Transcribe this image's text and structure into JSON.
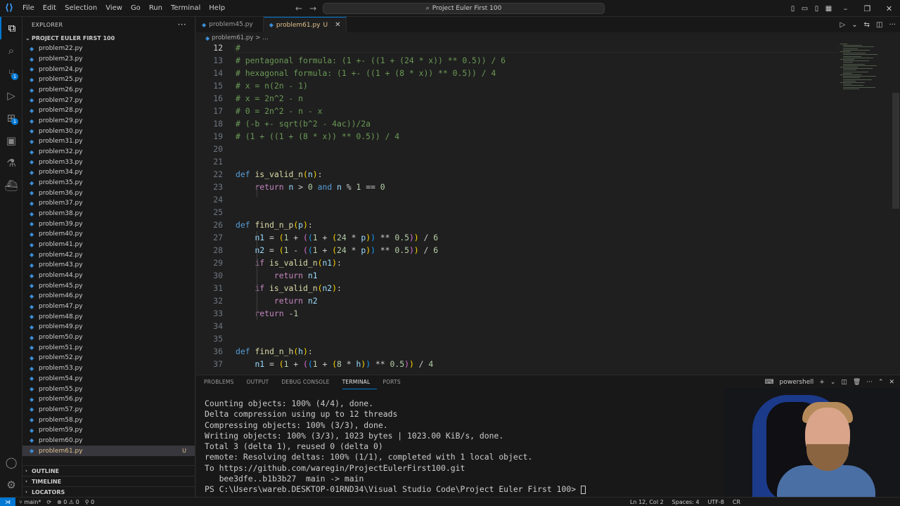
{
  "window": {
    "title": "Project Euler First 100"
  },
  "menu": [
    "File",
    "Edit",
    "Selection",
    "View",
    "Go",
    "Run",
    "Terminal",
    "Help"
  ],
  "sidebar": {
    "header": "EXPLORER",
    "folder": "PROJECT EULER FIRST 100",
    "files": [
      "problem22.py",
      "problem23.py",
      "problem24.py",
      "problem25.py",
      "problem26.py",
      "problem27.py",
      "problem28.py",
      "problem29.py",
      "problem30.py",
      "problem31.py",
      "problem32.py",
      "problem33.py",
      "problem34.py",
      "problem35.py",
      "problem36.py",
      "problem37.py",
      "problem38.py",
      "problem39.py",
      "problem40.py",
      "problem41.py",
      "problem42.py",
      "problem43.py",
      "problem44.py",
      "problem45.py",
      "problem46.py",
      "problem47.py",
      "problem48.py",
      "problem49.py",
      "problem50.py",
      "problem51.py",
      "problem52.py",
      "problem53.py",
      "problem54.py",
      "problem55.py",
      "problem56.py",
      "problem57.py",
      "problem58.py",
      "problem59.py",
      "problem60.py",
      "problem61.py"
    ],
    "active_file": "problem61.py",
    "active_status": "U",
    "sections": [
      "OUTLINE",
      "TIMELINE",
      "LOCATORS"
    ]
  },
  "activity_badges": {
    "source_control": "1",
    "extensions": "1"
  },
  "tabs": [
    {
      "label": "problem45.py",
      "active": false
    },
    {
      "label": "problem61.py",
      "modified": "U",
      "active": true
    }
  ],
  "breadcrumb": {
    "file": "problem61.py",
    "sep": ">",
    "rest": "..."
  },
  "code": {
    "current_line": 12,
    "lines": [
      {
        "n": "12",
        "html": "<span class='c-com'>#</span>"
      },
      {
        "n": "13",
        "html": "<span class='c-com'># pentagonal formula: (1 +- ((1 + (24 * x)) ** 0.5)) / 6</span>"
      },
      {
        "n": "14",
        "html": "<span class='c-com'># hexagonal formula: (1 +- ((1 + (8 * x)) ** 0.5)) / 4</span>"
      },
      {
        "n": "15",
        "html": "<span class='c-com'># x = n(2n - 1)</span>"
      },
      {
        "n": "16",
        "html": "<span class='c-com'># x = 2n^2 - n</span>"
      },
      {
        "n": "17",
        "html": "<span class='c-com'># 0 = 2n^2 - n - x</span>"
      },
      {
        "n": "18",
        "html": "<span class='c-com'># (-b +- sqrt(b^2 - 4ac))/2a</span>"
      },
      {
        "n": "19",
        "html": "<span class='c-com'># (1 + ((1 + (8 * x)) ** 0.5)) / 4</span>"
      },
      {
        "n": "20",
        "html": ""
      },
      {
        "n": "21",
        "html": ""
      },
      {
        "n": "22",
        "html": "<span class='c-kw'>def</span> <span class='c-fn'>is_valid_n</span><span class='c-par1'>(</span><span class='c-var'>n</span><span class='c-par1'>)</span>:"
      },
      {
        "n": "23",
        "html": "    <span class='c-ctl'>return</span> <span class='c-var'>n</span> &gt; <span class='c-num'>0</span> <span class='c-kw'>and</span> <span class='c-var'>n</span> % <span class='c-num'>1</span> == <span class='c-num'>0</span>"
      },
      {
        "n": "24",
        "html": ""
      },
      {
        "n": "25",
        "html": ""
      },
      {
        "n": "26",
        "html": "<span class='c-kw'>def</span> <span class='c-fn'>find_n_p</span><span class='c-par1'>(</span><span class='c-var'>p</span><span class='c-par1'>)</span>:"
      },
      {
        "n": "27",
        "html": "    <span class='c-var'>n1</span> = <span class='c-par1'>(</span><span class='c-num'>1</span> + <span class='c-par2'>(</span><span class='c-par3'>(</span><span class='c-num'>1</span> + <span class='c-par1'>(</span><span class='c-num'>24</span> * <span class='c-var'>p</span><span class='c-par1'>)</span><span class='c-par3'>)</span> ** <span class='c-num'>0.5</span><span class='c-par2'>)</span><span class='c-par1'>)</span> / <span class='c-num'>6</span>"
      },
      {
        "n": "28",
        "html": "    <span class='c-var'>n2</span> = <span class='c-par1'>(</span><span class='c-num'>1</span> - <span class='c-par2'>(</span><span class='c-par3'>(</span><span class='c-num'>1</span> + <span class='c-par1'>(</span><span class='c-num'>24</span> * <span class='c-var'>p</span><span class='c-par1'>)</span><span class='c-par3'>)</span> ** <span class='c-num'>0.5</span><span class='c-par2'>)</span><span class='c-par1'>)</span> / <span class='c-num'>6</span>"
      },
      {
        "n": "29",
        "html": "    <span class='c-ctl'>if</span> <span class='c-fn'>is_valid_n</span><span class='c-par1'>(</span><span class='c-var'>n1</span><span class='c-par1'>)</span>:"
      },
      {
        "n": "30",
        "html": "        <span class='c-ctl'>return</span> <span class='c-var'>n1</span>"
      },
      {
        "n": "31",
        "html": "    <span class='c-ctl'>if</span> <span class='c-fn'>is_valid_n</span><span class='c-par1'>(</span><span class='c-var'>n2</span><span class='c-par1'>)</span>:"
      },
      {
        "n": "32",
        "html": "        <span class='c-ctl'>return</span> <span class='c-var'>n2</span>"
      },
      {
        "n": "33",
        "html": "    <span class='c-ctl'>return</span> -<span class='c-num'>1</span>"
      },
      {
        "n": "34",
        "html": ""
      },
      {
        "n": "35",
        "html": ""
      },
      {
        "n": "36",
        "html": "<span class='c-kw'>def</span> <span class='c-fn'>find_n_h</span><span class='c-par1'>(</span><span class='c-var'>h</span><span class='c-par1'>)</span>:"
      },
      {
        "n": "37",
        "html": "    <span class='c-var'>n1</span> = <span class='c-par1'>(</span><span class='c-num'>1</span> + <span class='c-par2'>(</span><span class='c-par3'>(</span><span class='c-num'>1</span> + <span class='c-par1'>(</span><span class='c-num'>8</span> * <span class='c-var'>h</span><span class='c-par1'>)</span><span class='c-par3'>)</span> ** <span class='c-num'>0.5</span><span class='c-par2'>)</span><span class='c-par1'>)</span> / <span class='c-num'>4</span>"
      }
    ]
  },
  "panel": {
    "tabs": [
      "PROBLEMS",
      "OUTPUT",
      "DEBUG CONSOLE",
      "TERMINAL",
      "PORTS"
    ],
    "active_tab": "TERMINAL",
    "shell": "powershell",
    "terminal_lines": [
      "Counting objects: 100% (4/4), done.",
      "Delta compression using up to 12 threads",
      "Compressing objects: 100% (3/3), done.",
      "Writing objects: 100% (3/3), 1023 bytes | 1023.00 KiB/s, done.",
      "Total 3 (delta 1), reused 0 (delta 0)",
      "remote: Resolving deltas: 100% (1/1), completed with 1 local object.",
      "To https://github.com/waregin/ProjectEulerFirst100.git",
      "   bee3dfe..b1b3b27  main -> main",
      "PS C:\\Users\\wareb.DESKTOP-01RND34\\Visual Studio Code\\Project Euler First 100> "
    ]
  },
  "statusbar": {
    "branch": "main*",
    "errors": "0",
    "warnings": "0",
    "ports": "0",
    "position": "Ln 12, Col 2",
    "spaces": "Spaces: 4",
    "encoding": "UTF-8",
    "eol": "CR"
  },
  "colors": {
    "accent": "#0078d4",
    "modified": "#e2c08d",
    "comment": "#6a9955",
    "keyword": "#569cd6",
    "function": "#dcdcaa"
  }
}
